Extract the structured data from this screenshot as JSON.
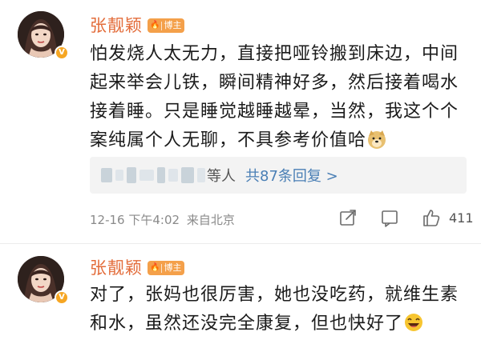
{
  "comments": [
    {
      "author": "张靓颖",
      "badge_label": "博主",
      "text": "怕发烧人太无力，直接把哑铃搬到床边，中间起来举会儿铁，瞬间精神好多，然后接着喝水接着睡。只是睡觉越睡越晕，当然，我这个个案纯属个人无聊，不具参考价值哈",
      "trailing_emoji": "doge-emoji",
      "replies": {
        "etc_label": "等人",
        "count_label": "共87条回复 >"
      },
      "timestamp": "12-16 下午4:02",
      "source": "来自北京",
      "like_count": "411"
    },
    {
      "author": "张靓颖",
      "badge_label": "博主",
      "text": "对了，张妈也很厉害，她也没吃药，就维生素和水，虽然还没完全康复，但也快好了",
      "trailing_emoji": "laugh-emoji"
    }
  ],
  "colors": {
    "name": "#e36c3a",
    "badge": "#f4a04a",
    "reply_link": "#4a7fb5",
    "meta": "#8a8a8a"
  }
}
